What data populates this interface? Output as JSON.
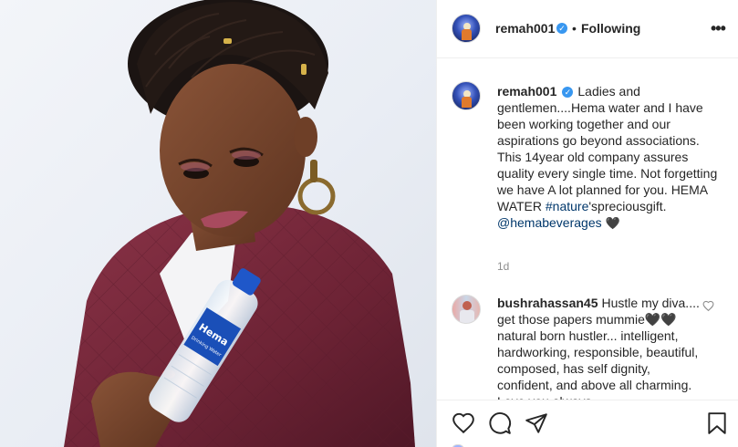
{
  "post": {
    "username": "remah001",
    "verified_glyph": "✓",
    "separator": "•",
    "follow_state": "Following",
    "more_glyph": "•••"
  },
  "caption": {
    "username": "remah001",
    "text": "Ladies and gentlemen....Hema water and I have been working together and our aspirations go beyond associations. This 14year old company assures quality every single time. Not forgetting we have A lot planned for you. HEMA WATER",
    "hashtag": "#nature",
    "hashtag_suffix": "'spreciousgift.",
    "mention": "@hemabeverages",
    "emoji": "🖤",
    "time": "1d"
  },
  "comment": {
    "username": "bushrahassan45",
    "text": "Hustle my diva.... get those papers mummie🖤🖤 natural born hustler... intelligent, hardworking, responsible, beautiful, composed, has self dignity, confident, and above all charming. Love you always"
  },
  "photo": {
    "bottle_label": "Hema",
    "bottle_sublabel": "Drinking Water"
  },
  "icons": {
    "like": "heart-icon",
    "comment": "speech-bubble-icon",
    "share": "paper-plane-icon",
    "save": "bookmark-icon",
    "comment_like": "heart-icon",
    "more": "ellipsis-icon"
  },
  "colors": {
    "verified": "#3897f0",
    "link": "#00376b",
    "jacket": "#7a2a3c",
    "secondary_text": "#8e8e8e"
  }
}
